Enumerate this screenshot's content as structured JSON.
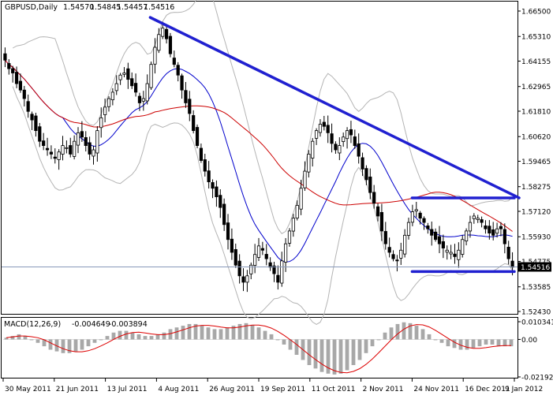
{
  "header": {
    "symbol": "GBPUSD,Daily",
    "ohlc": [
      "1.54570",
      "1.54845",
      "1.54457",
      "1.54516"
    ]
  },
  "macd_panel": {
    "label": "MACD(12,26,9)",
    "values": [
      "-0.004649",
      "-0.003894"
    ]
  },
  "price_axis": {
    "ticks": [
      "1.66500",
      "1.65310",
      "1.64155",
      "1.62965",
      "1.61810",
      "1.60620",
      "1.59465",
      "1.58275",
      "1.57120",
      "1.55930",
      "1.54775",
      "1.53585",
      "1.52430"
    ],
    "current_price": "1.54516"
  },
  "macd_axis": {
    "ticks": [
      "0.010341",
      "0.00",
      "-0.02192"
    ]
  },
  "date_axis": [
    "30 May 2011",
    "21 Jun 2011",
    "13 Jul 2011",
    "4 Aug 2011",
    "26 Aug 2011",
    "19 Sep 2011",
    "11 Oct 2011",
    "2 Nov 2011",
    "24 Nov 2011",
    "16 Dec 2011",
    "9 Jan 2012"
  ],
  "colors": {
    "background": "#ffffff",
    "candle": "#000000",
    "ma_fast": "#0000cc",
    "ma_slow": "#cc0000",
    "bollinger": "#b4b4b4",
    "trendline": "#2020d0",
    "macd_hist": "#a8a8a8",
    "macd_signal": "#dd0000",
    "price_marker_bg": "#000000",
    "price_marker_text": "#ffffff"
  },
  "chart_data": [
    {
      "type": "candlestick",
      "title": "GBPUSD,Daily",
      "ylim": [
        1.5243,
        1.665
      ],
      "x": [
        "30 May 2011",
        "21 Jun 2011",
        "13 Jul 2011",
        "4 Aug 2011",
        "26 Aug 2011",
        "19 Sep 2011",
        "11 Oct 2011",
        "2 Nov 2011",
        "24 Nov 2011",
        "16 Dec 2011",
        "9 Jan 2012"
      ],
      "close_path": [
        1.642,
        1.638,
        1.636,
        1.631,
        1.628,
        1.624,
        1.618,
        1.614,
        1.609,
        1.604,
        1.602,
        1.6,
        1.598,
        1.596,
        1.599,
        1.602,
        1.601,
        1.598,
        1.604,
        1.608,
        1.606,
        1.602,
        1.598,
        1.6,
        1.609,
        1.615,
        1.62,
        1.624,
        1.627,
        1.631,
        1.635,
        1.636,
        1.633,
        1.63,
        1.627,
        1.622,
        1.624,
        1.631,
        1.64,
        1.648,
        1.654,
        1.657,
        1.652,
        1.645,
        1.64,
        1.635,
        1.628,
        1.622,
        1.617,
        1.609,
        1.602,
        1.595,
        1.59,
        1.585,
        1.582,
        1.578,
        1.573,
        1.565,
        1.558,
        1.552,
        1.546,
        1.541,
        1.538,
        1.541,
        1.546,
        1.551,
        1.555,
        1.553,
        1.549,
        1.545,
        1.542,
        1.538,
        1.548,
        1.556,
        1.562,
        1.568,
        1.574,
        1.582,
        1.59,
        1.598,
        1.604,
        1.609,
        1.612,
        1.611,
        1.608,
        1.603,
        1.6,
        1.602,
        1.606,
        1.609,
        1.607,
        1.602,
        1.597,
        1.591,
        1.586,
        1.58,
        1.575,
        1.569,
        1.562,
        1.556,
        1.552,
        1.549,
        1.548,
        1.553,
        1.56,
        1.566,
        1.571,
        1.572,
        1.568,
        1.566,
        1.563,
        1.56,
        1.558,
        1.556,
        1.554,
        1.553,
        1.552,
        1.55,
        1.553,
        1.558,
        1.562,
        1.566,
        1.569,
        1.568,
        1.566,
        1.563,
        1.561,
        1.56,
        1.563,
        1.563,
        1.556,
        1.549,
        1.545
      ],
      "series": [
        {
          "kind": "moving-average",
          "color": "blue"
        },
        {
          "kind": "moving-average",
          "color": "red"
        },
        {
          "kind": "bollinger-bands",
          "color": "grey"
        }
      ],
      "trendlines": [
        {
          "from": [
            "4 Aug 2011",
            1.662
          ],
          "to": [
            "9 Jan 2012",
            1.5775
          ]
        },
        {
          "level": 1.5775,
          "from": "24 Nov 2011",
          "to": "9 Jan 2012"
        },
        {
          "level": 1.543,
          "from": "24 Nov 2011",
          "to": "9 Jan 2012"
        }
      ],
      "last_price": 1.54516
    },
    {
      "type": "bar",
      "title": "MACD(12,26,9)",
      "ylim": [
        -0.02192,
        0.010341
      ],
      "values_shape": [
        0.001,
        0.002,
        0.003,
        0.002,
        0.0,
        -0.002,
        -0.004,
        -0.006,
        -0.007,
        -0.008,
        -0.008,
        -0.007,
        -0.006,
        -0.004,
        -0.002,
        0.0,
        0.002,
        0.004,
        0.005,
        0.005,
        0.004,
        0.003,
        0.002,
        0.002,
        0.003,
        0.004,
        0.006,
        0.007,
        0.008,
        0.009,
        0.009,
        0.008,
        0.007,
        0.006,
        0.006,
        0.007,
        0.008,
        0.009,
        0.0095,
        0.0085,
        0.007,
        0.005,
        0.003,
        0.0,
        -0.003,
        -0.006,
        -0.009,
        -0.012,
        -0.015,
        -0.017,
        -0.019,
        -0.02,
        -0.0205,
        -0.02,
        -0.018,
        -0.015,
        -0.012,
        -0.008,
        -0.004,
        0.0,
        0.004,
        0.007,
        0.009,
        0.01,
        0.0095,
        0.008,
        0.006,
        0.003,
        0.0,
        -0.002,
        -0.004,
        -0.005,
        -0.006,
        -0.006,
        -0.005,
        -0.004,
        -0.003,
        -0.003,
        -0.004,
        -0.004,
        -0.004
      ],
      "signal": "moving-average of MACD"
    }
  ]
}
